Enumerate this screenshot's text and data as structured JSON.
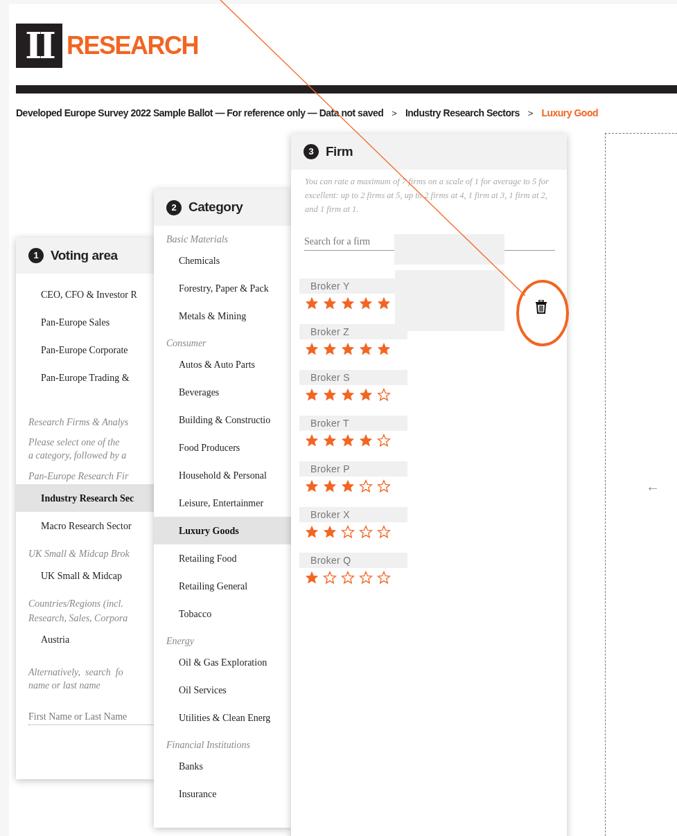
{
  "logo": {
    "mark": "II",
    "word": "RESEARCH"
  },
  "breadcrumb": [
    {
      "label": "Developed Europe Survey 2022 Sample Ballot — For reference only — Data not saved",
      "current": false
    },
    {
      "label": "Industry Research Sectors",
      "current": false
    },
    {
      "label": "Luxury Good",
      "current": true
    }
  ],
  "breadcrumb_separator": ">",
  "voting_area": {
    "number": "1",
    "title": "Voting area",
    "items": [
      {
        "kind": "item",
        "label": "CEO, CFO & Investor R",
        "selected": false
      },
      {
        "kind": "item",
        "label": "Pan-Europe Sales",
        "selected": false
      },
      {
        "kind": "item",
        "label": "Pan-Europe Corporate",
        "selected": false
      },
      {
        "kind": "item",
        "label": "Pan-Europe Trading &",
        "selected": false
      },
      {
        "kind": "heading",
        "label": "Research Firms & Analys"
      },
      {
        "kind": "note",
        "label": "Please select one of the"
      },
      {
        "kind": "note",
        "label": "a category, followed by a"
      },
      {
        "kind": "heading",
        "label": "Pan-Europe Research Fir"
      },
      {
        "kind": "item",
        "label": "Industry Research Sec",
        "selected": true
      },
      {
        "kind": "item",
        "label": "Macro Research Sector",
        "selected": false
      },
      {
        "kind": "heading",
        "label": "UK Small & Midcap Brok"
      },
      {
        "kind": "item",
        "label": "UK Small & Midcap",
        "selected": false
      },
      {
        "kind": "heading",
        "label": "Countries/Regions (incl."
      },
      {
        "kind": "heading",
        "label": "Research, Sales, Corpora"
      },
      {
        "kind": "item",
        "label": "Austria",
        "selected": false
      },
      {
        "kind": "note",
        "label": "Alternatively,  search  fo"
      },
      {
        "kind": "note",
        "label": "name or last name"
      },
      {
        "kind": "field",
        "placeholder": "First Name or Last Name"
      }
    ]
  },
  "category": {
    "number": "2",
    "title": "Category",
    "items": [
      {
        "kind": "heading",
        "label": "Basic Materials"
      },
      {
        "kind": "item",
        "label": "Chemicals",
        "selected": false
      },
      {
        "kind": "item",
        "label": "Forestry, Paper & Pack",
        "selected": false
      },
      {
        "kind": "item",
        "label": "Metals & Mining",
        "selected": false
      },
      {
        "kind": "heading",
        "label": "Consumer"
      },
      {
        "kind": "item",
        "label": "Autos & Auto Parts",
        "selected": false
      },
      {
        "kind": "item",
        "label": "Beverages",
        "selected": false
      },
      {
        "kind": "item",
        "label": "Building & Constructio",
        "selected": false
      },
      {
        "kind": "item",
        "label": "Food Producers",
        "selected": false
      },
      {
        "kind": "item",
        "label": "Household & Personal",
        "selected": false
      },
      {
        "kind": "item",
        "label": "Leisure, Entertainmer",
        "selected": false
      },
      {
        "kind": "item",
        "label": "Luxury Goods",
        "selected": true
      },
      {
        "kind": "item",
        "label": "Retailing Food",
        "selected": false
      },
      {
        "kind": "item",
        "label": "Retailing General",
        "selected": false
      },
      {
        "kind": "item",
        "label": "Tobacco",
        "selected": false
      },
      {
        "kind": "heading",
        "label": "Energy"
      },
      {
        "kind": "item",
        "label": "Oil & Gas Exploration",
        "selected": false
      },
      {
        "kind": "item",
        "label": "Oil Services",
        "selected": false
      },
      {
        "kind": "item",
        "label": "Utilities & Clean Energ",
        "selected": false
      },
      {
        "kind": "heading",
        "label": "Financial Institutions"
      },
      {
        "kind": "item",
        "label": "Banks",
        "selected": false
      },
      {
        "kind": "item",
        "label": "Insurance",
        "selected": false
      }
    ]
  },
  "firm": {
    "number": "3",
    "title": "Firm",
    "note": "You can rate a maximum of 7 firms on a scale of 1 for average to 5 for excellent: up to 2 firms at 5, up to 2 firms at 4, 1 firm at 3, 1 firm at 2, and 1 firm at 1.",
    "search": {
      "placeholder": "Search for a firm"
    },
    "firms": [
      {
        "name": "Broker Y",
        "stars": 5,
        "show_delete": true
      },
      {
        "name": "Broker Z",
        "stars": 5,
        "show_delete": false
      },
      {
        "name": "Broker S",
        "stars": 4,
        "show_delete": false
      },
      {
        "name": "Broker T",
        "stars": 4,
        "show_delete": false
      },
      {
        "name": "Broker P",
        "stars": 3,
        "show_delete": false
      },
      {
        "name": "Broker X",
        "stars": 2,
        "show_delete": false
      },
      {
        "name": "Broker Q",
        "stars": 1,
        "show_delete": false
      }
    ]
  },
  "back_arrow": "←"
}
